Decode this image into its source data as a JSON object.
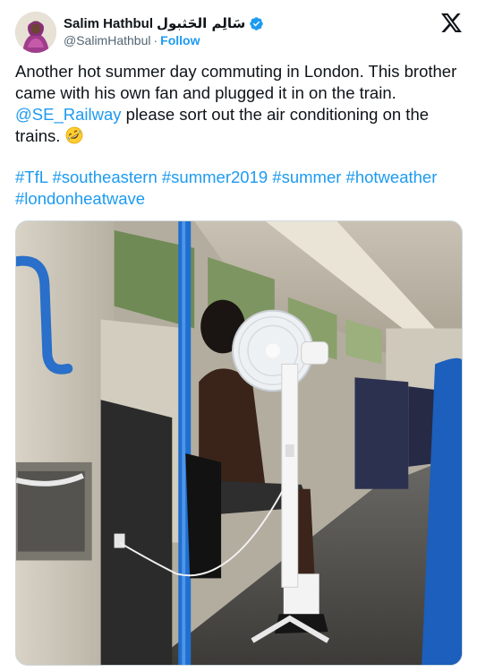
{
  "author": {
    "display_name": "Salim Hathbul",
    "display_name_ar": "سَالِم الحَثبول",
    "handle": "@SalimHathbul",
    "separator": "·",
    "follow_label": "Follow"
  },
  "tweet": {
    "text_before_mention": "Another hot summer day commuting in London. This brother came with his own fan and plugged it in on the train. ",
    "mention": "@SE_Railway",
    "text_after_mention": " please sort out the air conditioning on the trains. ",
    "emoji_icon": "rolling-on-floor-laughing-emoji",
    "hashtags": [
      "#TfL",
      "#southeastern",
      "#summer2019",
      "#summer",
      "#hotweather",
      "#londonheatwave"
    ]
  },
  "icons": {
    "verified": "verified-badge-icon",
    "platform": "x-logo-icon"
  },
  "colors": {
    "link_blue": "#1d9bf0",
    "text": "#0f1419",
    "muted": "#536471",
    "train_pole_blue": "#1f6fd0"
  }
}
